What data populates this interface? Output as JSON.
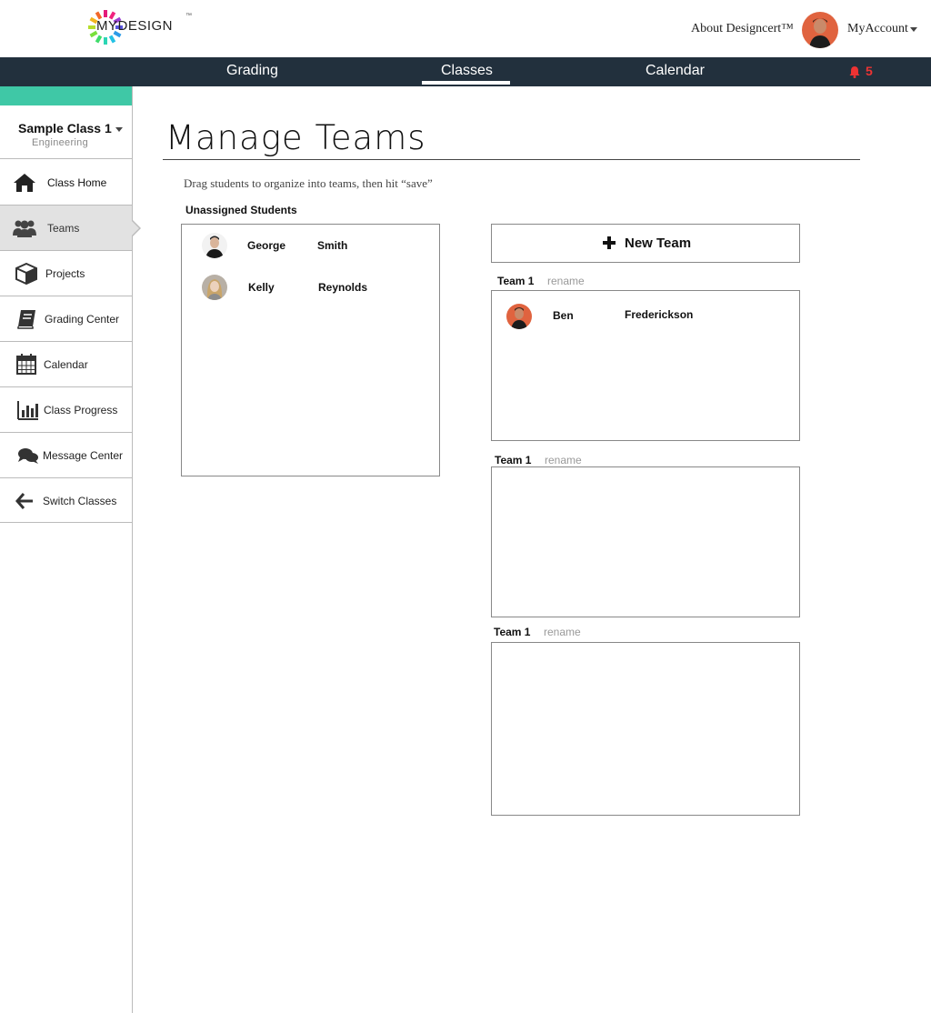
{
  "header": {
    "logo_text": "MYDESIGN",
    "logo_tm": "™",
    "about_link": "About Designcert™",
    "account_label": "MyAccount"
  },
  "nav": {
    "items": [
      "Grading",
      "Classes",
      "Calendar"
    ],
    "active": "Classes",
    "notification_count": "5"
  },
  "sidebar": {
    "class_name": "Sample Class 1",
    "class_subject": "Engineering",
    "items": [
      {
        "label": "Class Home",
        "icon": "home-icon"
      },
      {
        "label": "Teams",
        "icon": "users-icon"
      },
      {
        "label": "Projects",
        "icon": "cube-icon"
      },
      {
        "label": "Grading Center",
        "icon": "book-icon"
      },
      {
        "label": "Calendar",
        "icon": "calendar-icon"
      },
      {
        "label": "Class Progress",
        "icon": "bar-chart-icon"
      },
      {
        "label": "Message Center",
        "icon": "chat-icon"
      },
      {
        "label": "Switch Classes",
        "icon": "arrow-left-icon"
      }
    ],
    "active_item": "Teams"
  },
  "main": {
    "title": "Manage Teams",
    "instructions": "Drag students to organize into teams, then hit “save”",
    "unassigned_label": "Unassigned Students",
    "unassigned_students": [
      {
        "first": "George",
        "last": "Smith"
      },
      {
        "first": "Kelly",
        "last": "Reynolds"
      }
    ],
    "new_team_label": "New Team",
    "rename_label": "rename",
    "teams": [
      {
        "name": "Team 1",
        "members": [
          {
            "first": "Ben",
            "last": "Frederickson"
          }
        ]
      },
      {
        "name": "Team 1",
        "members": []
      },
      {
        "name": "Team 1",
        "members": []
      }
    ]
  },
  "colors": {
    "navbar": "#22303d",
    "accent_teal": "#3fc8a6",
    "notification": "#ee3333"
  }
}
